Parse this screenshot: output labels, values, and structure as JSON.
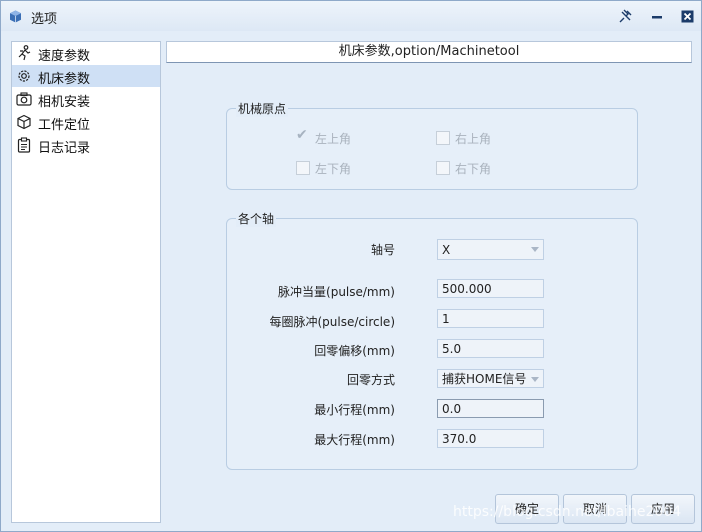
{
  "window": {
    "title": "选项"
  },
  "sidebar": {
    "items": [
      {
        "label": "速度参数",
        "icon": "run-icon",
        "selected": false
      },
      {
        "label": "机床参数",
        "icon": "gear-icon",
        "selected": true
      },
      {
        "label": "相机安装",
        "icon": "camera-icon",
        "selected": false
      },
      {
        "label": "工件定位",
        "icon": "cube-icon",
        "selected": false
      },
      {
        "label": "日志记录",
        "icon": "clipboard-icon",
        "selected": false
      }
    ]
  },
  "header": {
    "title": "机床参数,option/Machinetool"
  },
  "origin_group": {
    "title": "机械原点",
    "options": [
      {
        "label": "左上角",
        "checked": true
      },
      {
        "label": "右上角",
        "checked": false
      },
      {
        "label": "左下角",
        "checked": false
      },
      {
        "label": "右下角",
        "checked": false
      }
    ]
  },
  "axis_group": {
    "title": "各个轴",
    "fields": [
      {
        "label": "轴号",
        "value": "X",
        "type": "select"
      },
      {
        "label": "脉冲当量(pulse/mm)",
        "value": "500.000",
        "type": "input"
      },
      {
        "label": "每圈脉冲(pulse/circle)",
        "value": "1",
        "type": "input"
      },
      {
        "label": "回零偏移(mm)",
        "value": "5.0",
        "type": "input"
      },
      {
        "label": "回零方式",
        "value": "捕获HOME信号",
        "type": "select"
      },
      {
        "label": "最小行程(mm)",
        "value": "0.0",
        "type": "input"
      },
      {
        "label": "最大行程(mm)",
        "value": "370.0",
        "type": "input"
      }
    ]
  },
  "buttons": {
    "ok": "确定",
    "cancel": "取消",
    "apply": "应用"
  },
  "watermark": "https://blog.csdn.net/lbaihe2004"
}
